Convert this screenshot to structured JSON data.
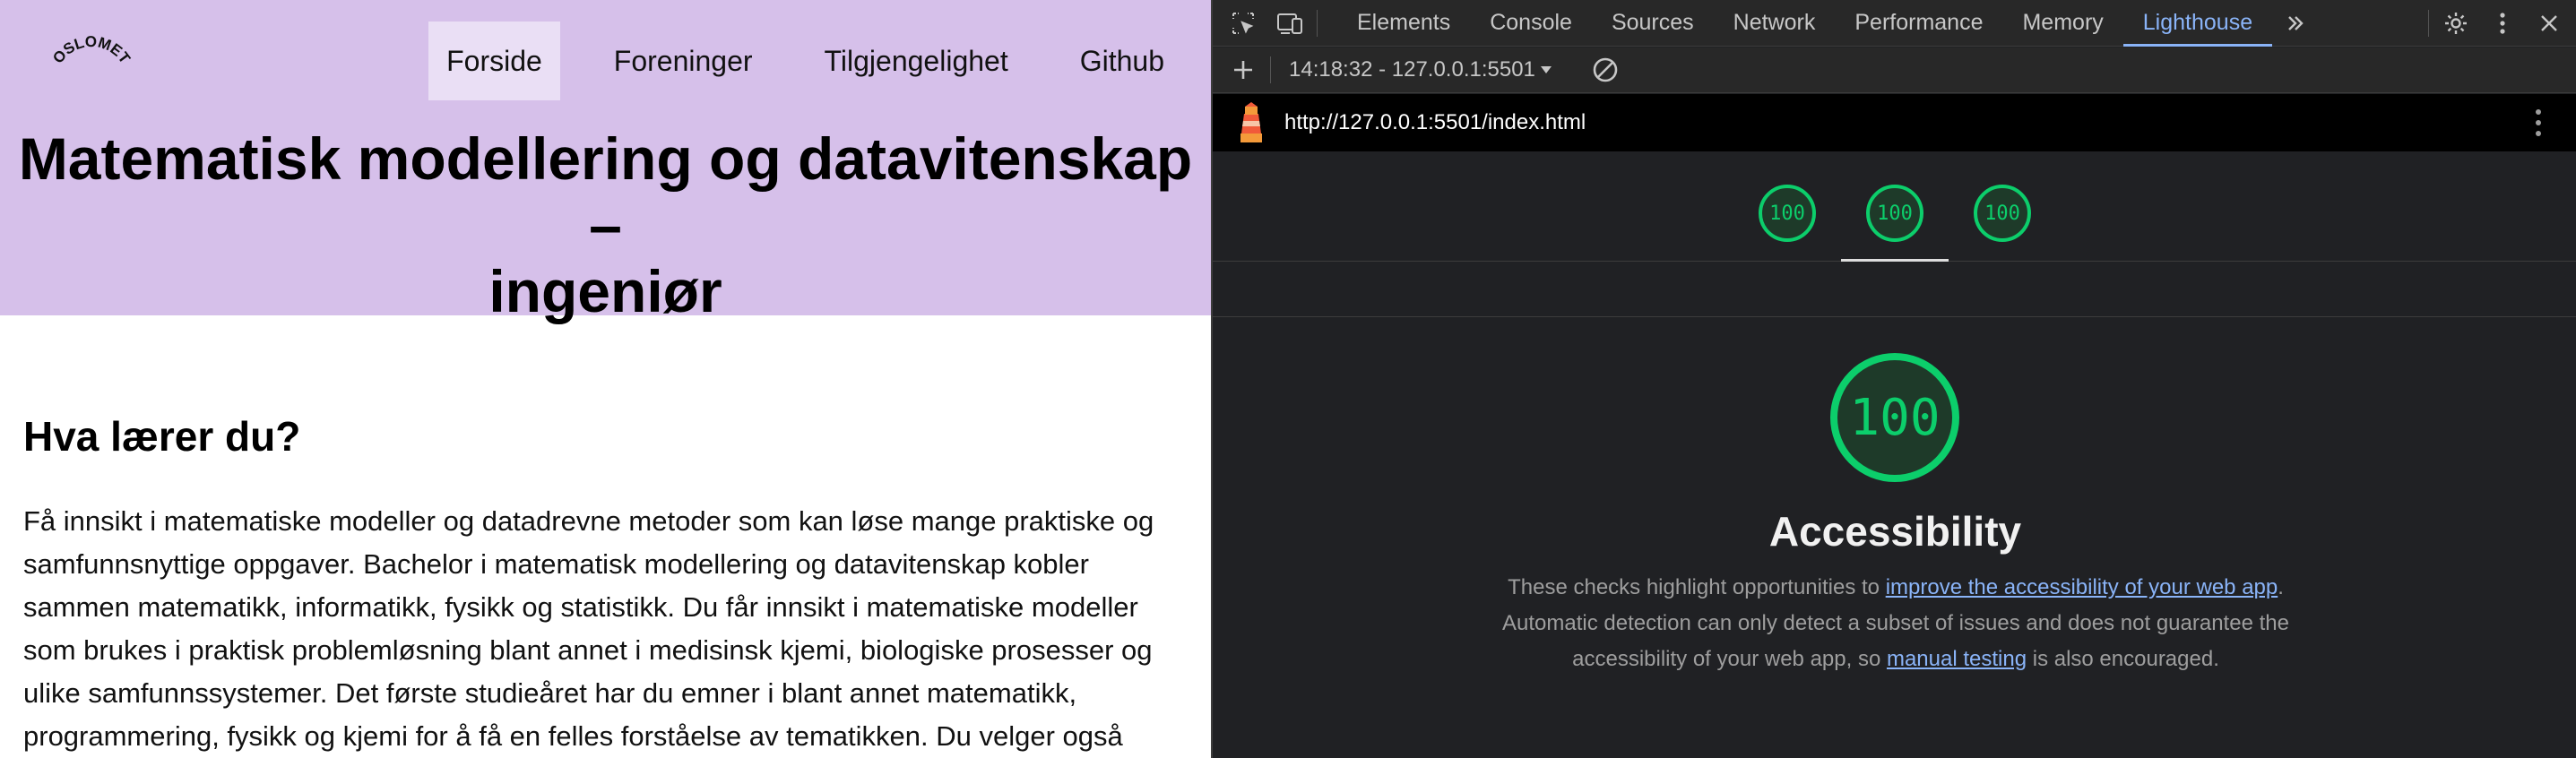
{
  "site": {
    "logo_text": "OSLOMET",
    "nav": [
      {
        "label": "Forside",
        "active": true
      },
      {
        "label": "Foreninger",
        "active": false
      },
      {
        "label": "Tilgjengelighet",
        "active": false
      },
      {
        "label": "Github",
        "active": false
      }
    ],
    "title_line1": "Matematisk modellering og datavitenskap –",
    "title_line2": "ingeniør",
    "heading": "Hva lærer du?",
    "paragraph": "Få innsikt i matematiske modeller og datadrevne metoder som kan løse mange praktiske og samfunnsnyttige oppgaver. Bachelor i matematisk modellering og datavitenskap kobler sammen matematikk, informatikk, fysikk og statistikk. Du får innsikt i matematiske modeller som brukes i praktisk problemløsning blant annet i medisinsk kjemi, biologiske prosesser og ulike samfunnssystemer. Det første studieåret har du emner i blant annet matematikk, programmering, fysikk og kjemi for å få en felles forståelse av tematikken. Du velger også",
    "header_bg": "#d6c0ea"
  },
  "devtools": {
    "tabs": [
      {
        "label": "Elements",
        "active": false
      },
      {
        "label": "Console",
        "active": false
      },
      {
        "label": "Sources",
        "active": false
      },
      {
        "label": "Network",
        "active": false
      },
      {
        "label": "Performance",
        "active": false
      },
      {
        "label": "Memory",
        "active": false
      },
      {
        "label": "Lighthouse",
        "active": true
      }
    ],
    "icons": {
      "inspect": "inspect-element-icon",
      "device": "device-toolbar-icon",
      "more_tabs": "chevron-double-right-icon",
      "settings": "gear-icon",
      "menu": "kebab-menu-icon",
      "close": "close-icon",
      "add": "plus-icon",
      "clear": "clear-icon",
      "lighthouse": "lighthouse-icon"
    },
    "session": "14:18:32 - 127.0.0.1:5501",
    "url": "http://127.0.0.1:5501/index.html",
    "scores": [
      "100",
      "100",
      "100"
    ],
    "active_score_index": 1,
    "category": {
      "score": "100",
      "title": "Accessibility",
      "desc_part1": "These checks highlight opportunities to ",
      "link1": "improve the accessibility of your web app",
      "desc_part2": ". Automatic detection can only detect a subset of issues and does not guarantee the accessibility of your web app, so ",
      "link2": "manual testing",
      "desc_part3": " is also encouraged."
    },
    "accent": "#8ab4f8",
    "pass_color": "#0cce6b"
  }
}
